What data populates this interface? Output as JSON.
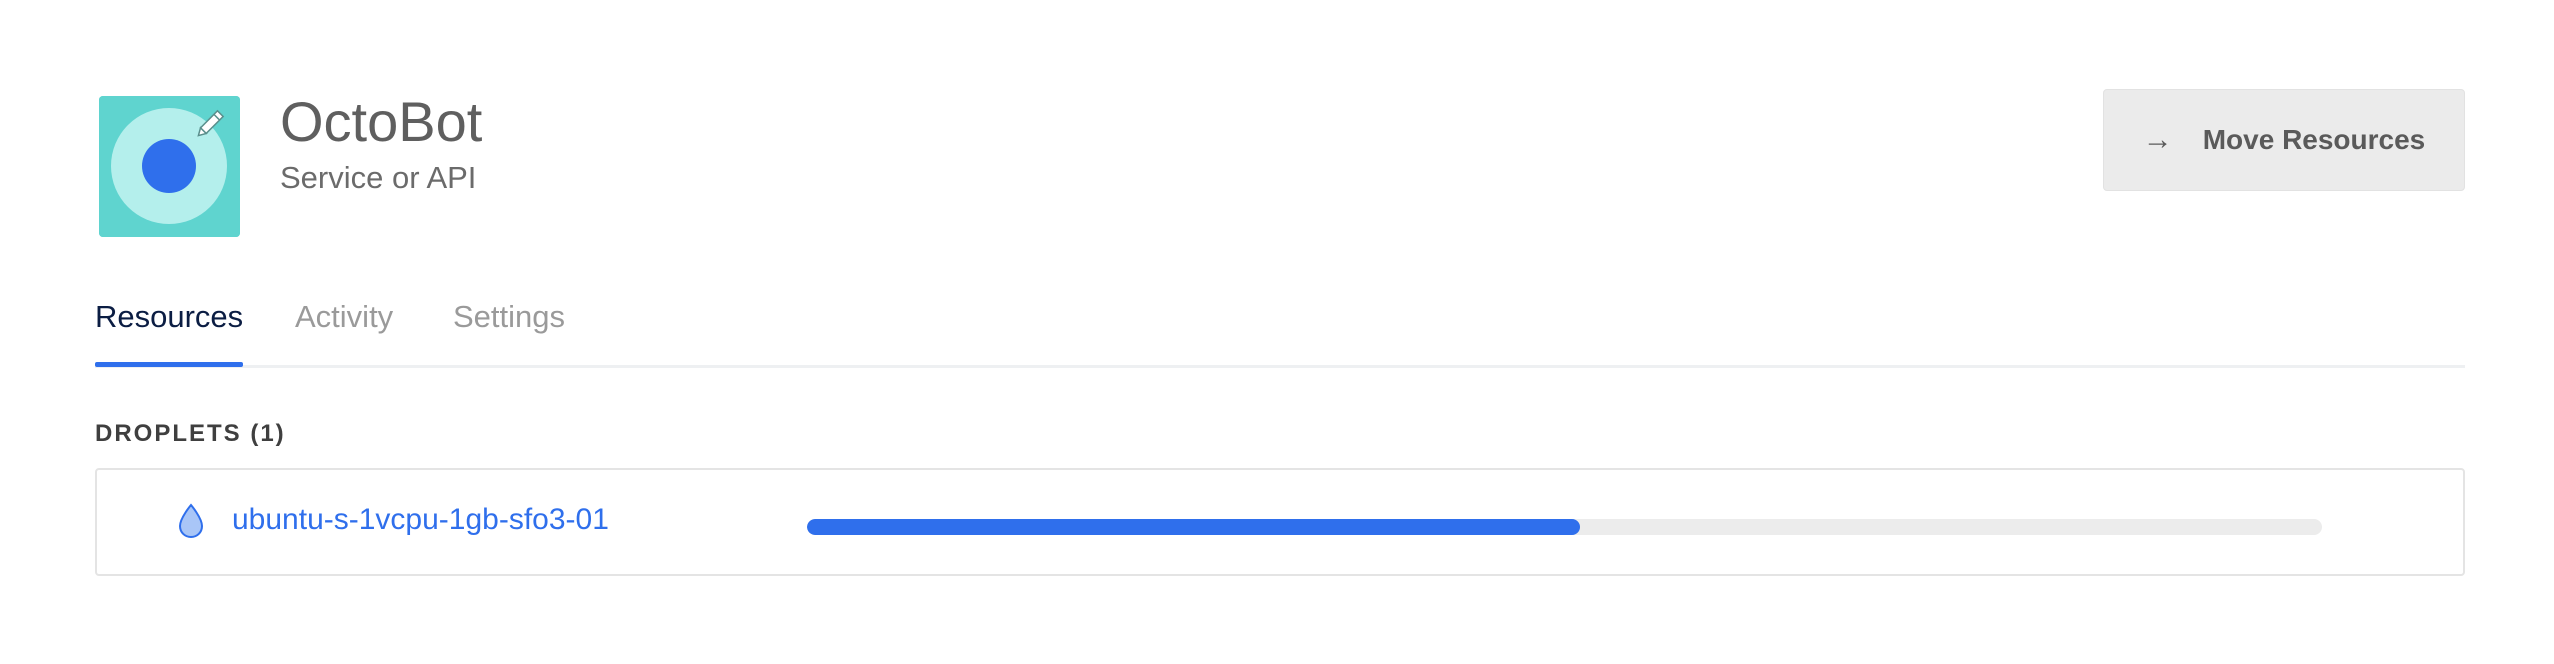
{
  "project": {
    "name": "OctoBot",
    "purpose": "Service or API",
    "icon": "project-avatar-icon",
    "edit_icon": "pencil-icon"
  },
  "header": {
    "move_button": {
      "icon": "arrow-right-icon",
      "arrow_glyph": "→",
      "label": "Move Resources"
    }
  },
  "tabs": [
    {
      "label": "Resources",
      "active": true
    },
    {
      "label": "Activity",
      "active": false
    },
    {
      "label": "Settings",
      "active": false
    }
  ],
  "droplets": {
    "heading": "DROPLETS (1)",
    "items": [
      {
        "name": "ubuntu-s-1vcpu-1gb-sfo3-01",
        "icon": "droplet-icon",
        "progress": 0.51
      }
    ]
  },
  "colors": {
    "accent": "#2f6fec",
    "tab_active": "#0b1d43",
    "icon_bg": "#5fd4cf"
  }
}
